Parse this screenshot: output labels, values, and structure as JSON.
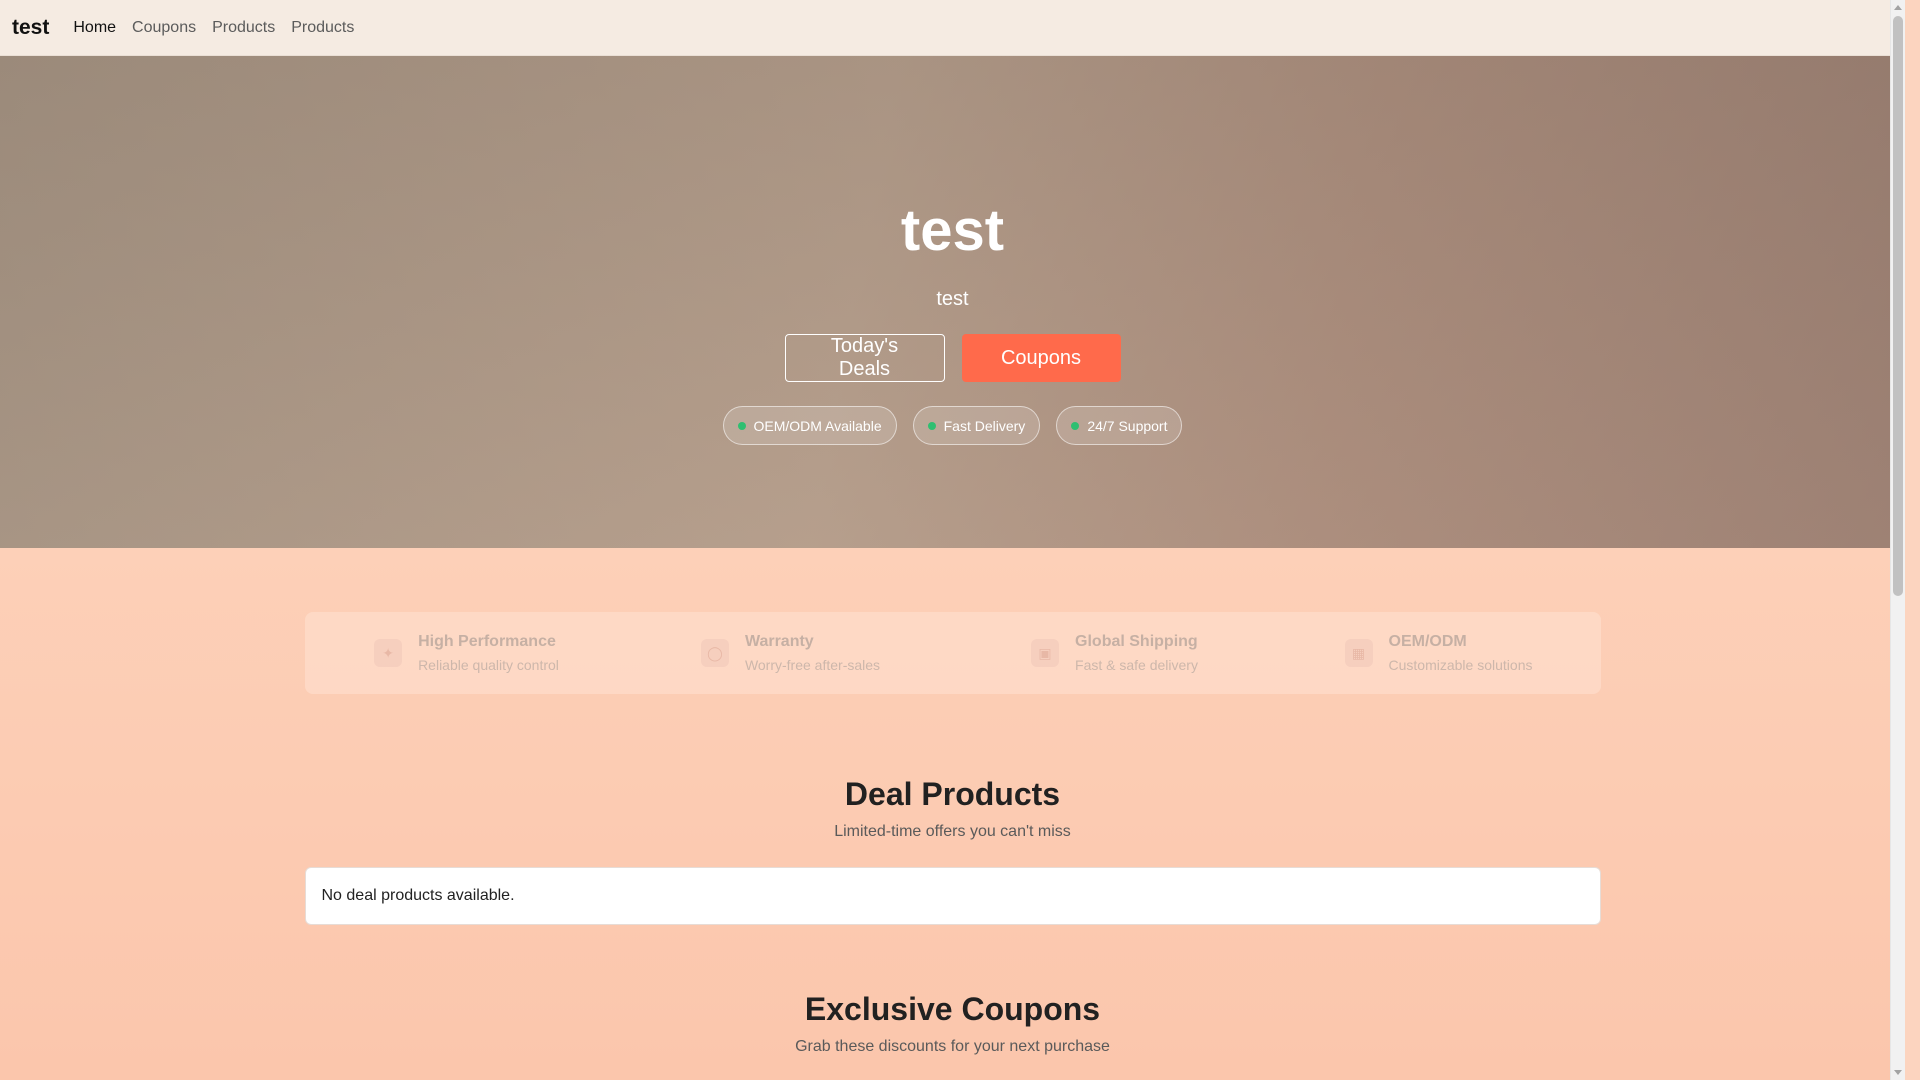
{
  "nav": {
    "brand": "test",
    "links": [
      "Home",
      "Coupons",
      "Products",
      "Products"
    ]
  },
  "hero": {
    "title": "test",
    "subtitle": "test",
    "deals_button": "Today's Deals",
    "coupons_button": "Coupons",
    "badges": [
      "OEM/ODM Available",
      "Fast Delivery",
      "24/7 Support"
    ]
  },
  "features": [
    {
      "icon": "rocket-icon",
      "title": "High Performance",
      "desc": "Reliable quality control"
    },
    {
      "icon": "shield-icon",
      "title": "Warranty",
      "desc": "Worry-free after-sales"
    },
    {
      "icon": "truck-icon",
      "title": "Global Shipping",
      "desc": "Fast & safe delivery"
    },
    {
      "icon": "factory-icon",
      "title": "OEM/ODM",
      "desc": "Customizable solutions"
    }
  ],
  "deals": {
    "title": "Deal Products",
    "subtitle": "Limited-time offers you can't miss",
    "empty": "No deal products available."
  },
  "coupons": {
    "title": "Exclusive Coupons",
    "subtitle": "Grab these discounts for your next purchase"
  },
  "colors": {
    "accent": "#ff6a4b",
    "badge_dot": "#2fbf71",
    "nav_bg": "#f5ebe2"
  }
}
